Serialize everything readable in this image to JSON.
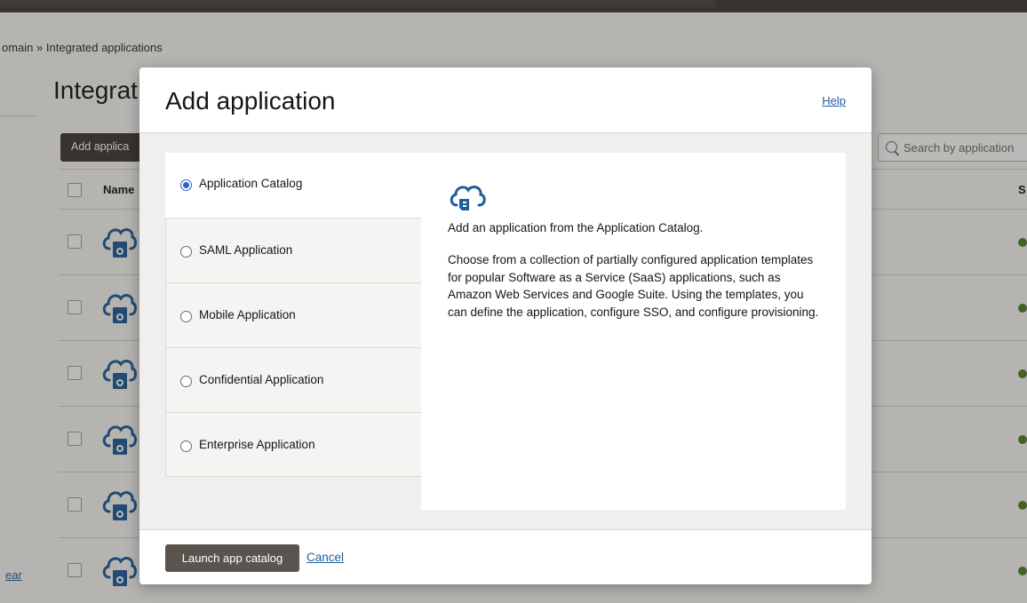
{
  "breadcrumb": {
    "prefix": "omain",
    "separator": "»",
    "current": "Integrated applications"
  },
  "page": {
    "title": "Integrat",
    "add_button_label": "Add applica",
    "search_placeholder": "Search by application",
    "table_header": {
      "name": "Name",
      "status": "S"
    },
    "row_count": 6,
    "clear_link": "ear"
  },
  "modal": {
    "title": "Add application",
    "help_label": "Help",
    "options": [
      {
        "label": "Application Catalog",
        "selected": true
      },
      {
        "label": "SAML Application",
        "selected": false
      },
      {
        "label": "Mobile Application",
        "selected": false
      },
      {
        "label": "Confidential Application",
        "selected": false
      },
      {
        "label": "Enterprise Application",
        "selected": false
      }
    ],
    "detail": {
      "icon": "cloud-app-icon",
      "lead": "Add an application from the Application Catalog.",
      "description": "Choose from a collection of partially configured application templates for popular Software as a Service (SaaS) applications, such as Amazon Web Services and Google Suite. Using the templates, you can define the application, configure SSO, and configure provisioning."
    },
    "footer": {
      "launch_label": "Launch app catalog",
      "cancel_label": "Cancel"
    }
  },
  "colors": {
    "accent_blue": "#1f5e9c",
    "radio_selected": "#2b65c7",
    "primary_button": "#5b534d",
    "status_green": "#508223",
    "icon_blue": "#1f5e9c"
  }
}
